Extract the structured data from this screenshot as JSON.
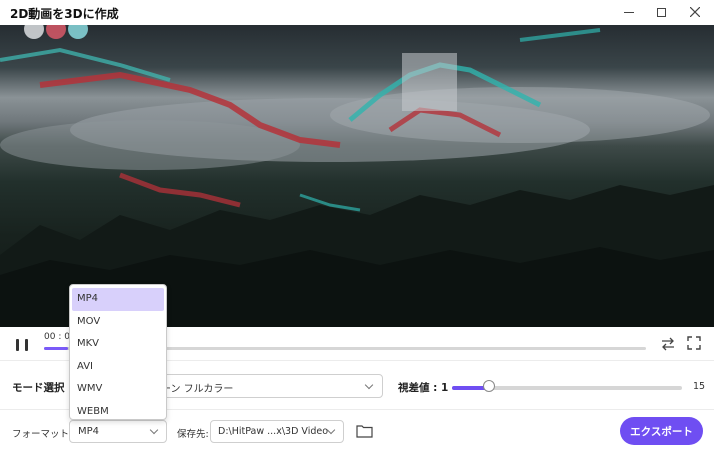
{
  "window": {
    "title": "2D動画を3Dに作成"
  },
  "player": {
    "time": "00 : 00",
    "progress": 0.04
  },
  "settings": {
    "mode_label": "モード選択 :",
    "mode_value": "ーン フルカラー",
    "parallax_label": "視差値 : ",
    "parallax_value": "1",
    "parallax_max": "15",
    "parallax_level": 0.16
  },
  "output": {
    "format_label": "フォーマット:",
    "format_value": "MP4",
    "format_options": [
      "MP4",
      "MOV",
      "MKV",
      "AVI",
      "WMV",
      "WEBM"
    ],
    "save_label": "保存先:",
    "save_path": "D:\\HitPaw ...x\\3D Video",
    "export_label": "エクスポート"
  },
  "colors": {
    "accent": "#6f4ef2",
    "dropdown_selected": "#d8d0fb"
  }
}
